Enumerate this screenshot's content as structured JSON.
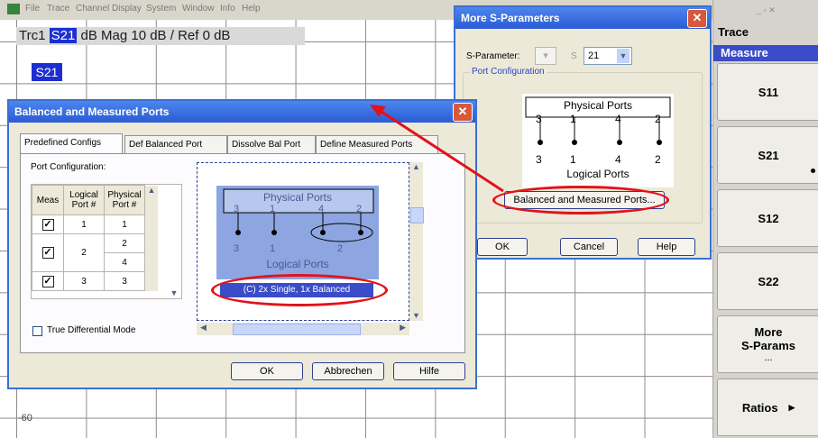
{
  "menu": [
    "File",
    "Trace",
    "Channel",
    "Display",
    "System",
    "Window",
    "Info",
    "Help"
  ],
  "trace_info": {
    "trc": "Trc1",
    "param": "S21",
    "rest": "dB Mag  10 dB /  Ref 0 dB"
  },
  "badge": "S21",
  "y_label": "-60",
  "panel": {
    "title": "Trace",
    "subtitle": "Measure",
    "keys": [
      {
        "label": "S11"
      },
      {
        "label": "S21"
      },
      {
        "label": "S12"
      },
      {
        "label": "S22"
      },
      {
        "label": "More\nS-Params",
        "sub": "..."
      },
      {
        "label": "Ratios",
        "arrow": "▸"
      }
    ]
  },
  "more_dialog": {
    "title": "More S-Parameters",
    "sparam_label": "S-Parameter:",
    "s_prefix": "S",
    "sparam_value": "21",
    "group_label": "Port Configuration",
    "physical_ports": "Physical Ports",
    "logical_ports": "Logical Ports",
    "phys_nums": [
      "3",
      "1",
      "4",
      "2"
    ],
    "log_nums": [
      "3",
      "1",
      "4",
      "2"
    ],
    "balanced_button": "Balanced and Measured Ports...",
    "ok": "OK",
    "cancel": "Cancel",
    "help": "Help"
  },
  "balanced_dialog": {
    "title": "Balanced and Measured Ports",
    "tabs": [
      "Predefined Configs",
      "Def Balanced Port",
      "Dissolve Bal Port",
      "Define Measured Ports"
    ],
    "port_config_label": "Port Configuration:",
    "table_headers": [
      "Meas",
      "Logical Port #",
      "Physical Port #"
    ],
    "rows": [
      {
        "logical": "1",
        "physical": "1"
      },
      {
        "logical": "2",
        "physical": "2"
      },
      {
        "logical": "",
        "physical": "4"
      },
      {
        "logical": "3",
        "physical": "3"
      }
    ],
    "diagram_physical": "Physical Ports",
    "diagram_logical": "Logical Ports",
    "diagram_phys_nums": [
      "3",
      "1",
      "4",
      "2"
    ],
    "diagram_log_nums": [
      "3",
      "1",
      "2"
    ],
    "caption": "(C) 2x Single, 1x Balanced",
    "true_diff": "True Differential Mode",
    "ok": "OK",
    "cancel": "Abbrechen",
    "help": "Hilfe"
  },
  "colors": {
    "accent": "#1d2fd0",
    "highlight": "#e1131a",
    "title_bar": "#2a5bd6"
  }
}
